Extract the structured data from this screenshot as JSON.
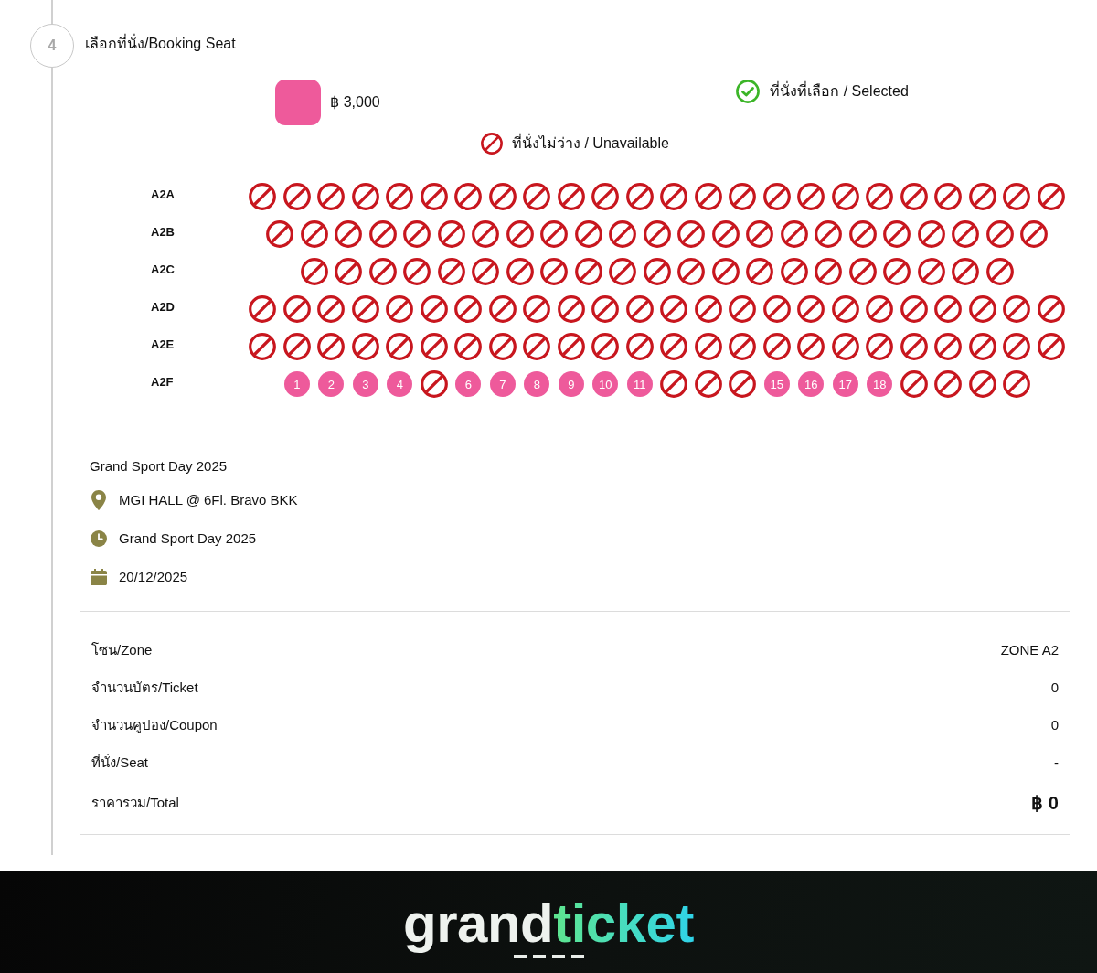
{
  "step": {
    "number": "4",
    "title": "เลือกที่นั่ง/Booking Seat"
  },
  "legend": [
    {
      "kind": "price",
      "label": "฿ 3,000",
      "color": "#ee5a9b"
    },
    {
      "kind": "selected",
      "label": "ที่นั่งที่เลือก / Selected"
    },
    {
      "kind": "unavailable",
      "label": "ที่นั่งไม่ว่าง / Unavailable"
    }
  ],
  "seat_rows": [
    {
      "label": "A2A",
      "seats": [
        {
          "kind": "unavailable",
          "selected": false
        },
        {
          "kind": "unavailable",
          "selected": false
        },
        {
          "kind": "unavailable",
          "selected": false
        },
        {
          "kind": "unavailable",
          "selected": false
        },
        {
          "kind": "unavailable",
          "selected": false
        },
        {
          "kind": "unavailable",
          "selected": false
        },
        {
          "kind": "unavailable",
          "selected": false
        },
        {
          "kind": "unavailable",
          "selected": false
        },
        {
          "kind": "unavailable",
          "selected": false
        },
        {
          "kind": "unavailable",
          "selected": false
        },
        {
          "kind": "unavailable",
          "selected": false
        },
        {
          "kind": "unavailable",
          "selected": false
        },
        {
          "kind": "unavailable",
          "selected": false
        },
        {
          "kind": "unavailable",
          "selected": false
        },
        {
          "kind": "unavailable",
          "selected": false
        },
        {
          "kind": "unavailable",
          "selected": false
        },
        {
          "kind": "unavailable",
          "selected": false
        },
        {
          "kind": "unavailable",
          "selected": false
        },
        {
          "kind": "unavailable",
          "selected": false
        },
        {
          "kind": "unavailable",
          "selected": false
        },
        {
          "kind": "unavailable",
          "selected": false
        },
        {
          "kind": "unavailable",
          "selected": false
        },
        {
          "kind": "unavailable",
          "selected": false
        },
        {
          "kind": "unavailable",
          "selected": false
        }
      ]
    },
    {
      "label": "A2B",
      "seats": [
        {
          "kind": "unavailable",
          "selected": false
        },
        {
          "kind": "unavailable",
          "selected": false
        },
        {
          "kind": "unavailable",
          "selected": false
        },
        {
          "kind": "unavailable",
          "selected": false
        },
        {
          "kind": "unavailable",
          "selected": false
        },
        {
          "kind": "unavailable",
          "selected": false
        },
        {
          "kind": "unavailable",
          "selected": false
        },
        {
          "kind": "unavailable",
          "selected": false
        },
        {
          "kind": "unavailable",
          "selected": false
        },
        {
          "kind": "unavailable",
          "selected": false
        },
        {
          "kind": "unavailable",
          "selected": false
        },
        {
          "kind": "unavailable",
          "selected": false
        },
        {
          "kind": "unavailable",
          "selected": false
        },
        {
          "kind": "unavailable",
          "selected": false
        },
        {
          "kind": "unavailable",
          "selected": false
        },
        {
          "kind": "unavailable",
          "selected": false
        },
        {
          "kind": "unavailable",
          "selected": false
        },
        {
          "kind": "unavailable",
          "selected": false
        },
        {
          "kind": "unavailable",
          "selected": false
        },
        {
          "kind": "unavailable",
          "selected": false
        },
        {
          "kind": "unavailable",
          "selected": false
        },
        {
          "kind": "unavailable",
          "selected": false
        },
        {
          "kind": "unavailable",
          "selected": false
        }
      ]
    },
    {
      "label": "A2C",
      "seats": [
        {
          "kind": "unavailable",
          "selected": false
        },
        {
          "kind": "unavailable",
          "selected": false
        },
        {
          "kind": "unavailable",
          "selected": false
        },
        {
          "kind": "unavailable",
          "selected": false
        },
        {
          "kind": "unavailable",
          "selected": false
        },
        {
          "kind": "unavailable",
          "selected": false
        },
        {
          "kind": "unavailable",
          "selected": false
        },
        {
          "kind": "unavailable",
          "selected": false
        },
        {
          "kind": "unavailable",
          "selected": false
        },
        {
          "kind": "unavailable",
          "selected": false
        },
        {
          "kind": "unavailable",
          "selected": false
        },
        {
          "kind": "unavailable",
          "selected": false
        },
        {
          "kind": "unavailable",
          "selected": false
        },
        {
          "kind": "unavailable",
          "selected": false
        },
        {
          "kind": "unavailable",
          "selected": false
        },
        {
          "kind": "unavailable",
          "selected": false
        },
        {
          "kind": "unavailable",
          "selected": false
        },
        {
          "kind": "unavailable",
          "selected": false
        },
        {
          "kind": "unavailable",
          "selected": false
        },
        {
          "kind": "unavailable",
          "selected": false
        },
        {
          "kind": "unavailable",
          "selected": false
        }
      ]
    },
    {
      "label": "A2D",
      "seats": [
        {
          "kind": "unavailable",
          "selected": false
        },
        {
          "kind": "unavailable",
          "selected": false
        },
        {
          "kind": "unavailable",
          "selected": false
        },
        {
          "kind": "unavailable",
          "selected": false
        },
        {
          "kind": "unavailable",
          "selected": false
        },
        {
          "kind": "unavailable",
          "selected": false
        },
        {
          "kind": "unavailable",
          "selected": false
        },
        {
          "kind": "unavailable",
          "selected": false
        },
        {
          "kind": "unavailable",
          "selected": false
        },
        {
          "kind": "unavailable",
          "selected": false
        },
        {
          "kind": "unavailable",
          "selected": false
        },
        {
          "kind": "unavailable",
          "selected": false
        },
        {
          "kind": "unavailable",
          "selected": false
        },
        {
          "kind": "unavailable",
          "selected": false
        },
        {
          "kind": "unavailable",
          "selected": false
        },
        {
          "kind": "unavailable",
          "selected": false
        },
        {
          "kind": "unavailable",
          "selected": false
        },
        {
          "kind": "unavailable",
          "selected": false
        },
        {
          "kind": "unavailable",
          "selected": false
        },
        {
          "kind": "unavailable",
          "selected": false
        },
        {
          "kind": "unavailable",
          "selected": false
        },
        {
          "kind": "unavailable",
          "selected": false
        },
        {
          "kind": "unavailable",
          "selected": false
        },
        {
          "kind": "unavailable",
          "selected": false
        }
      ]
    },
    {
      "label": "A2E",
      "seats": [
        {
          "kind": "unavailable",
          "selected": false
        },
        {
          "kind": "unavailable",
          "selected": false
        },
        {
          "kind": "unavailable",
          "selected": false
        },
        {
          "kind": "unavailable",
          "selected": false
        },
        {
          "kind": "unavailable",
          "selected": false
        },
        {
          "kind": "unavailable",
          "selected": false
        },
        {
          "kind": "unavailable",
          "selected": false
        },
        {
          "kind": "unavailable",
          "selected": false
        },
        {
          "kind": "unavailable",
          "selected": false
        },
        {
          "kind": "unavailable",
          "selected": false
        },
        {
          "kind": "unavailable",
          "selected": false
        },
        {
          "kind": "unavailable",
          "selected": false
        },
        {
          "kind": "unavailable",
          "selected": false
        },
        {
          "kind": "unavailable",
          "selected": false
        },
        {
          "kind": "unavailable",
          "selected": false
        },
        {
          "kind": "unavailable",
          "selected": false
        },
        {
          "kind": "unavailable",
          "selected": false
        },
        {
          "kind": "unavailable",
          "selected": false
        },
        {
          "kind": "unavailable",
          "selected": false
        },
        {
          "kind": "unavailable",
          "selected": false
        },
        {
          "kind": "unavailable",
          "selected": false
        },
        {
          "kind": "unavailable",
          "selected": false
        },
        {
          "kind": "unavailable",
          "selected": false
        },
        {
          "kind": "unavailable",
          "selected": false
        }
      ]
    },
    {
      "label": "A2F",
      "seats": [
        {
          "kind": "available",
          "label": "1",
          "selected": false
        },
        {
          "kind": "available",
          "label": "2",
          "selected": false
        },
        {
          "kind": "available",
          "label": "3",
          "selected": false
        },
        {
          "kind": "available",
          "label": "4",
          "selected": false
        },
        {
          "kind": "unavailable",
          "selected": false
        },
        {
          "kind": "available",
          "label": "6",
          "selected": false
        },
        {
          "kind": "available",
          "label": "7",
          "selected": false
        },
        {
          "kind": "available",
          "label": "8",
          "selected": false
        },
        {
          "kind": "available",
          "label": "9",
          "selected": false
        },
        {
          "kind": "available",
          "label": "10",
          "selected": false
        },
        {
          "kind": "available",
          "label": "11",
          "selected": false
        },
        {
          "kind": "unavailable",
          "selected": false
        },
        {
          "kind": "unavailable",
          "selected": false
        },
        {
          "kind": "unavailable",
          "selected": false
        },
        {
          "kind": "available",
          "label": "15",
          "selected": false
        },
        {
          "kind": "available",
          "label": "16",
          "selected": false
        },
        {
          "kind": "available",
          "label": "17",
          "selected": false
        },
        {
          "kind": "available",
          "label": "18",
          "selected": false
        },
        {
          "kind": "unavailable",
          "selected": false
        },
        {
          "kind": "unavailable",
          "selected": false
        },
        {
          "kind": "unavailable",
          "selected": false
        },
        {
          "kind": "unavailable",
          "selected": false
        }
      ]
    }
  ],
  "event": {
    "title": "Grand Sport Day 2025",
    "details": [
      {
        "kind": "location",
        "text": "MGI HALL @ 6Fl. Bravo BKK"
      },
      {
        "kind": "time",
        "text": "Grand Sport Day 2025"
      },
      {
        "kind": "date",
        "text": "20/12/2025"
      }
    ]
  },
  "summary": [
    {
      "kind": "line",
      "label": "โซน/Zone",
      "value": "ZONE A2"
    },
    {
      "kind": "line",
      "label": "จำนวนบัตร/Ticket",
      "value": "0"
    },
    {
      "kind": "line",
      "label": "จำนวนคูปอง/Coupon",
      "value": "0"
    },
    {
      "kind": "line",
      "label": "ที่นั่ง/Seat",
      "value": "-"
    },
    {
      "kind": "total",
      "label": "ราคารวม/Total",
      "value": "฿ 0"
    }
  ],
  "footer": {
    "logo": {
      "part_1": "grand",
      "part_2": "ticket"
    }
  }
}
